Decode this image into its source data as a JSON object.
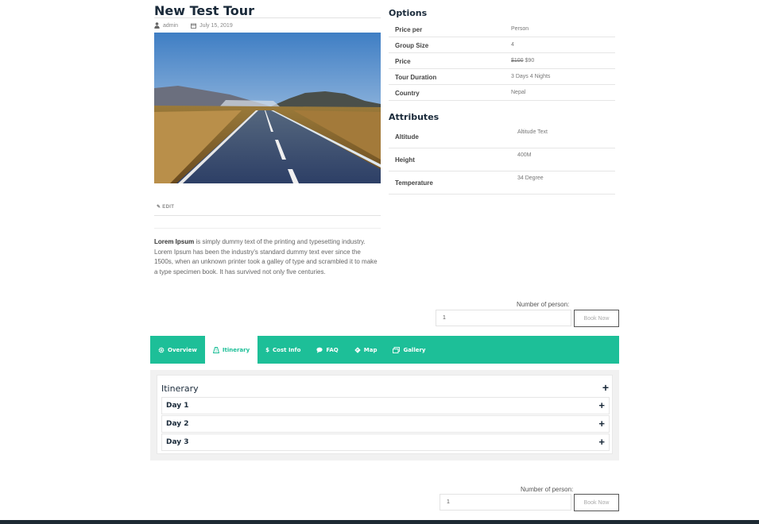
{
  "tour": {
    "title": "New Test Tour",
    "author": "admin",
    "date": "July 15, 2019",
    "edit_label": "EDIT",
    "description_bold": "Lorem Ipsum",
    "description_rest": " is simply dummy text of the printing and typesetting industry. Lorem Ipsum has been the industry's standard dummy text ever since the 1500s, when an unknown printer took a galley of type and scrambled it to make a type specimen book. It has survived not only five centuries."
  },
  "options": {
    "heading": "Options",
    "rows": [
      {
        "label": "Price per",
        "value": "Person"
      },
      {
        "label": "Group Size",
        "value": "4"
      },
      {
        "label": "Price",
        "old_value": "$100",
        "value": "$90"
      },
      {
        "label": "Tour Duration",
        "value": "3 Days 4 Nights"
      },
      {
        "label": "Country",
        "value": "Nepal"
      }
    ]
  },
  "attributes": {
    "heading": "Attributes",
    "rows": [
      {
        "label": "Altitude",
        "value": "Altitude Text"
      },
      {
        "label": "Height",
        "value": "400M"
      },
      {
        "label": "Temperature",
        "value": "34 Degree"
      }
    ]
  },
  "booking_top": {
    "label": "Number of person:",
    "value": "1",
    "button": "Book Now"
  },
  "booking_bottom": {
    "label": "Number of person:",
    "value": "1",
    "button": "Book Now"
  },
  "tabs": [
    {
      "label": "Overview",
      "icon": "gear-icon"
    },
    {
      "label": "Itinerary",
      "icon": "route-icon",
      "active": true
    },
    {
      "label": "Cost Info",
      "icon": "dollar-icon"
    },
    {
      "label": "FAQ",
      "icon": "chat-icon"
    },
    {
      "label": "Map",
      "icon": "map-icon"
    },
    {
      "label": "Gallery",
      "icon": "gallery-icon"
    }
  ],
  "itinerary": {
    "title": "Itinerary",
    "days": [
      "Day 1",
      "Day 2",
      "Day 3"
    ]
  },
  "colors": {
    "accent": "#1dbf98",
    "heading": "#1a2a3a",
    "footer": "#1e2a33"
  }
}
